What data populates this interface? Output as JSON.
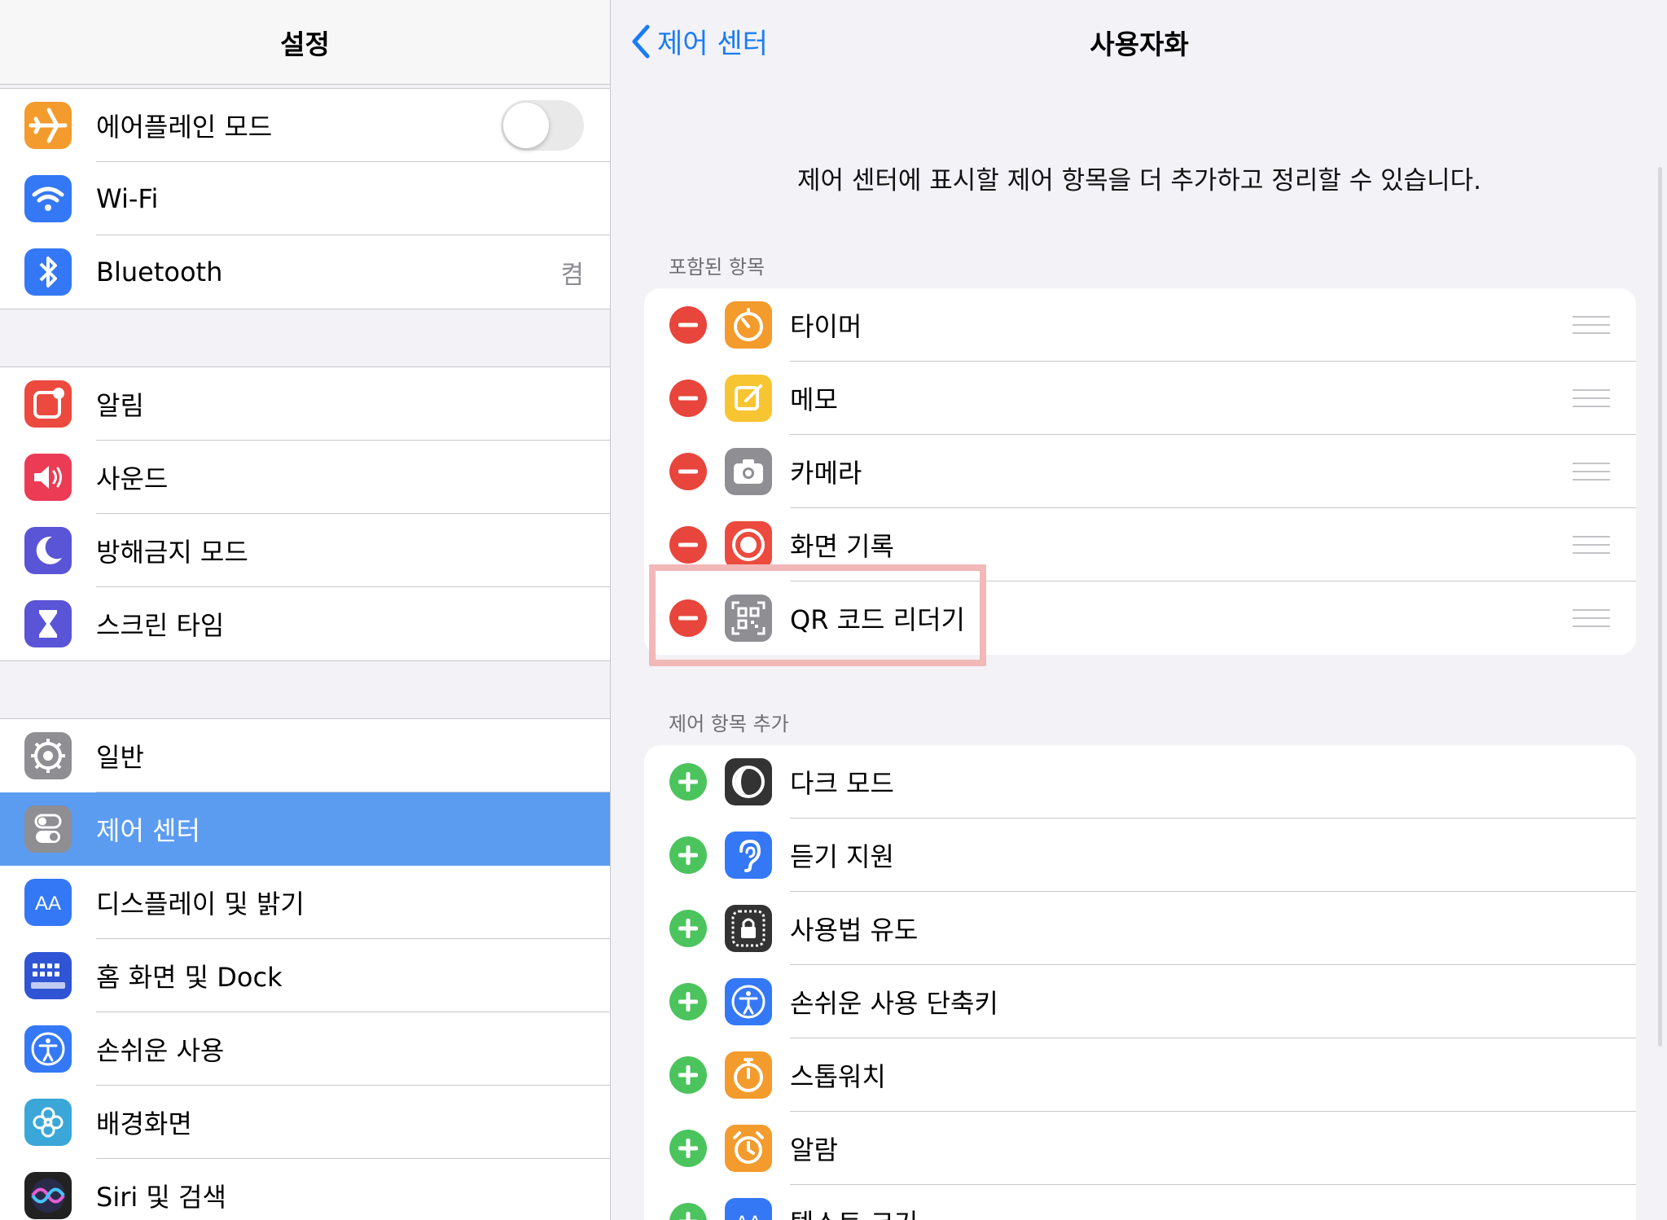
{
  "colors": {
    "accent": "#1a7cf5",
    "selected_row": "#5b9cf1",
    "remove": "#e8453c",
    "add": "#4cc45d"
  },
  "left": {
    "title": "설정",
    "groups": [
      [
        {
          "label": "에어플레인 모드",
          "icon": "airplane-icon",
          "color": "#f39b2c",
          "toggle": true
        },
        {
          "label": "Wi-Fi",
          "icon": "wifi-icon",
          "color": "#3478f6"
        },
        {
          "label": "Bluetooth",
          "icon": "bluetooth-icon",
          "color": "#3478f6",
          "value": "켬"
        }
      ],
      [
        {
          "label": "알림",
          "icon": "notification-icon",
          "color": "#ec4a3e"
        },
        {
          "label": "사운드",
          "icon": "speaker-icon",
          "color": "#ec3b55"
        },
        {
          "label": "방해금지 모드",
          "icon": "moon-icon",
          "color": "#5a54d6"
        },
        {
          "label": "스크린 타임",
          "icon": "hourglass-icon",
          "color": "#5a54d6"
        }
      ],
      [
        {
          "label": "일반",
          "icon": "gear-icon",
          "color": "#8e8e93"
        },
        {
          "label": "제어 센터",
          "icon": "switches-icon",
          "color": "#8e8e93",
          "selected": true
        },
        {
          "label": "디스플레이 및 밝기",
          "icon": "text-size-icon",
          "color": "#3478f6"
        },
        {
          "label": "홈 화면 및 Dock",
          "icon": "home-grid-icon",
          "color": "#2f55d4"
        },
        {
          "label": "손쉬운 사용",
          "icon": "accessibility-icon",
          "color": "#3478f6"
        },
        {
          "label": "배경화면",
          "icon": "flower-icon",
          "color": "#3aa7d8"
        },
        {
          "label": "Siri 및 검색",
          "icon": "siri-icon",
          "color": "#222"
        }
      ]
    ]
  },
  "right": {
    "back_label": "제어 센터",
    "title": "사용자화",
    "description": "제어 센터에 표시할 제어 항목을 더 추가하고 정리할 수 있습니다.",
    "included_header": "포함된 항목",
    "included": [
      {
        "label": "타이머",
        "icon": "timer-icon",
        "color": "#f39b2c"
      },
      {
        "label": "메모",
        "icon": "notes-icon",
        "color": "#f7c531"
      },
      {
        "label": "카메라",
        "icon": "camera-icon",
        "color": "#8e8e93"
      },
      {
        "label": "화면 기록",
        "icon": "record-icon",
        "color": "#ec4a3e"
      },
      {
        "label": "QR 코드 리더기",
        "icon": "qr-code-icon",
        "color": "#8e8e93"
      }
    ],
    "more_header": "제어 항목 추가",
    "more": [
      {
        "label": "다크 모드",
        "icon": "dark-mode-icon",
        "color": "#333"
      },
      {
        "label": "듣기 지원",
        "icon": "ear-icon",
        "color": "#3478f6"
      },
      {
        "label": "사용법 유도",
        "icon": "guided-access-icon",
        "color": "#333"
      },
      {
        "label": "손쉬운 사용 단축키",
        "icon": "accessibility-icon",
        "color": "#3478f6"
      },
      {
        "label": "스톱워치",
        "icon": "stopwatch-icon",
        "color": "#f39b2c"
      },
      {
        "label": "알람",
        "icon": "alarm-icon",
        "color": "#f39b2c"
      },
      {
        "label": "텍스트 크기",
        "icon": "text-size-icon",
        "color": "#3478f6"
      }
    ]
  }
}
